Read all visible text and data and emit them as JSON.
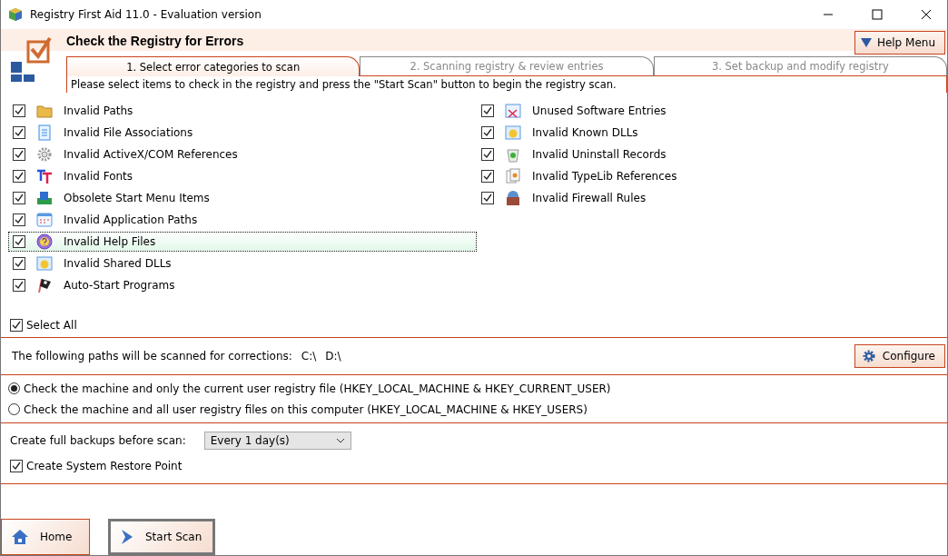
{
  "window": {
    "title": "Registry First Aid 11.0 - Evaluation version"
  },
  "header": {
    "title": "Check the Registry for Errors",
    "help_button": "Help Menu"
  },
  "tabs": [
    {
      "label": "1. Select error categories to scan",
      "selected": true
    },
    {
      "label": "2. Scanning registry & review entries",
      "selected": false
    },
    {
      "label": "3. Set backup and modify registry",
      "selected": false
    }
  ],
  "instruction": "Please select items to check in the registry and press the \"Start Scan\" button to begin the registry scan.",
  "categories_left": [
    {
      "label": "Invalid Paths",
      "checked": true,
      "selected": false
    },
    {
      "label": "Invalid File Associations",
      "checked": true,
      "selected": false
    },
    {
      "label": "Invalid ActiveX/COM References",
      "checked": true,
      "selected": false
    },
    {
      "label": "Invalid Fonts",
      "checked": true,
      "selected": false
    },
    {
      "label": "Obsolete Start Menu Items",
      "checked": true,
      "selected": false
    },
    {
      "label": "Invalid Application Paths",
      "checked": true,
      "selected": false
    },
    {
      "label": "Invalid Help Files",
      "checked": true,
      "selected": true
    },
    {
      "label": "Invalid Shared DLLs",
      "checked": true,
      "selected": false
    },
    {
      "label": "Auto-Start Programs",
      "checked": true,
      "selected": false
    }
  ],
  "categories_right": [
    {
      "label": "Unused Software Entries",
      "checked": true,
      "selected": false
    },
    {
      "label": "Invalid Known DLLs",
      "checked": true,
      "selected": false
    },
    {
      "label": "Invalid Uninstall Records",
      "checked": true,
      "selected": false
    },
    {
      "label": "Invalid TypeLib References",
      "checked": true,
      "selected": false
    },
    {
      "label": "Invalid Firewall Rules",
      "checked": true,
      "selected": false
    }
  ],
  "select_all": {
    "label": "Select All",
    "checked": true
  },
  "paths": {
    "label": "The following paths will be scanned for corrections:",
    "drives": [
      "C:\\",
      "D:\\"
    ],
    "button": "Configure"
  },
  "scope_options": [
    {
      "label": "Check the machine and only the current user registry file (HKEY_LOCAL_MACHINE & HKEY_CURRENT_USER)",
      "selected": true
    },
    {
      "label": "Check the machine and all user registry files on this computer (HKEY_LOCAL_MACHINE & HKEY_USERS)",
      "selected": false
    }
  ],
  "backup": {
    "label": "Create full backups before scan:",
    "value": "Every 1 day(s)"
  },
  "restore_point": {
    "label": "Create System Restore Point",
    "checked": true
  },
  "footer": {
    "home_button": "Home",
    "scan_button": "Start Scan"
  }
}
